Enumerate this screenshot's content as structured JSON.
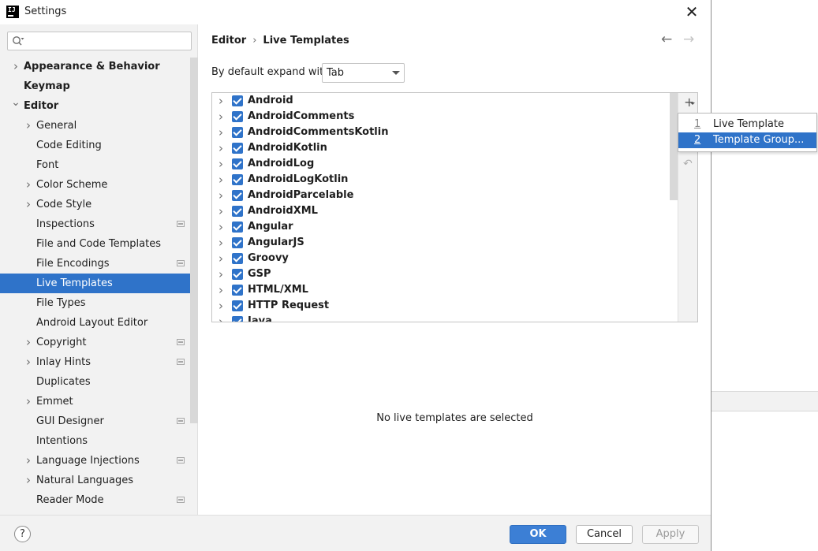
{
  "window": {
    "title": "Settings",
    "close_icon": "close-icon"
  },
  "search": {
    "placeholder": ""
  },
  "sidebar": {
    "items": [
      {
        "label": "Appearance & Behavior",
        "level": 0,
        "expandable": true,
        "expanded": false,
        "bold": true,
        "project": false
      },
      {
        "label": "Keymap",
        "level": 0,
        "expandable": false,
        "bold": true,
        "project": false
      },
      {
        "label": "Editor",
        "level": 0,
        "expandable": true,
        "expanded": true,
        "bold": true,
        "project": false
      },
      {
        "label": "General",
        "level": 1,
        "expandable": true,
        "expanded": false,
        "project": false
      },
      {
        "label": "Code Editing",
        "level": 1,
        "expandable": false,
        "project": false
      },
      {
        "label": "Font",
        "level": 1,
        "expandable": false,
        "project": false
      },
      {
        "label": "Color Scheme",
        "level": 1,
        "expandable": true,
        "expanded": false,
        "project": false
      },
      {
        "label": "Code Style",
        "level": 1,
        "expandable": true,
        "expanded": false,
        "project": false
      },
      {
        "label": "Inspections",
        "level": 1,
        "expandable": false,
        "project": true
      },
      {
        "label": "File and Code Templates",
        "level": 1,
        "expandable": false,
        "project": false
      },
      {
        "label": "File Encodings",
        "level": 1,
        "expandable": false,
        "project": true
      },
      {
        "label": "Live Templates",
        "level": 1,
        "expandable": false,
        "project": false,
        "selected": true
      },
      {
        "label": "File Types",
        "level": 1,
        "expandable": false,
        "project": false
      },
      {
        "label": "Android Layout Editor",
        "level": 1,
        "expandable": false,
        "project": false
      },
      {
        "label": "Copyright",
        "level": 1,
        "expandable": true,
        "expanded": false,
        "project": true
      },
      {
        "label": "Inlay Hints",
        "level": 1,
        "expandable": true,
        "expanded": false,
        "project": true
      },
      {
        "label": "Duplicates",
        "level": 1,
        "expandable": false,
        "project": false
      },
      {
        "label": "Emmet",
        "level": 1,
        "expandable": true,
        "expanded": false,
        "project": false
      },
      {
        "label": "GUI Designer",
        "level": 1,
        "expandable": false,
        "project": true
      },
      {
        "label": "Intentions",
        "level": 1,
        "expandable": false,
        "project": false
      },
      {
        "label": "Language Injections",
        "level": 1,
        "expandable": true,
        "expanded": false,
        "project": true
      },
      {
        "label": "Natural Languages",
        "level": 1,
        "expandable": true,
        "expanded": false,
        "project": false
      },
      {
        "label": "Reader Mode",
        "level": 1,
        "expandable": false,
        "project": true
      }
    ]
  },
  "breadcrumb": {
    "parent": "Editor",
    "separator": "›",
    "current": "Live Templates"
  },
  "expand": {
    "label": "By default expand with",
    "value": "Tab"
  },
  "template_groups": [
    {
      "name": "Android",
      "checked": true
    },
    {
      "name": "AndroidComments",
      "checked": true
    },
    {
      "name": "AndroidCommentsKotlin",
      "checked": true
    },
    {
      "name": "AndroidKotlin",
      "checked": true
    },
    {
      "name": "AndroidLog",
      "checked": true
    },
    {
      "name": "AndroidLogKotlin",
      "checked": true
    },
    {
      "name": "AndroidParcelable",
      "checked": true
    },
    {
      "name": "AndroidXML",
      "checked": true
    },
    {
      "name": "Angular",
      "checked": true
    },
    {
      "name": "AngularJS",
      "checked": true
    },
    {
      "name": "Groovy",
      "checked": true
    },
    {
      "name": "GSP",
      "checked": true
    },
    {
      "name": "HTML/XML",
      "checked": true
    },
    {
      "name": "HTTP Request",
      "checked": true
    },
    {
      "name": "Java",
      "checked": true
    }
  ],
  "popup_menu": {
    "items": [
      {
        "number": "1",
        "label": "Live Template",
        "selected": false
      },
      {
        "number": "2",
        "label": "Template Group...",
        "selected": true
      }
    ]
  },
  "empty_message": "No live templates are selected",
  "buttons": {
    "help": "?",
    "ok": "OK",
    "cancel": "Cancel",
    "apply": "Apply"
  },
  "colors": {
    "accent": "#2f73c9",
    "sidebar_bg": "#f2f2f2"
  }
}
